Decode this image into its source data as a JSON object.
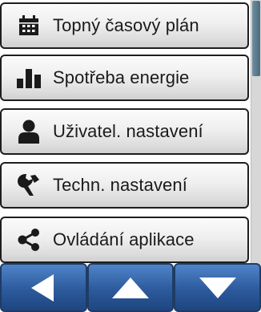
{
  "menu": {
    "items": [
      {
        "label": "Topný časový plán",
        "icon": "calendar-icon"
      },
      {
        "label": "Spotřeba energie",
        "icon": "bar-chart-icon"
      },
      {
        "label": "Uživatel. nastavení",
        "icon": "user-icon"
      },
      {
        "label": "Techn. nastavení",
        "icon": "wrench-icon"
      },
      {
        "label": "Ovládání aplikace",
        "icon": "share-icon"
      }
    ]
  },
  "navigation": {
    "buttons": [
      {
        "icon": "arrow-left-icon"
      },
      {
        "icon": "arrow-up-icon"
      },
      {
        "icon": "arrow-down-icon"
      }
    ]
  },
  "colors": {
    "nav_button": "#2c5a9c",
    "menu_item_border": "#1e1e1e",
    "icon": "#1a1a1a",
    "scroll_thumb": "#4b6b7c"
  }
}
